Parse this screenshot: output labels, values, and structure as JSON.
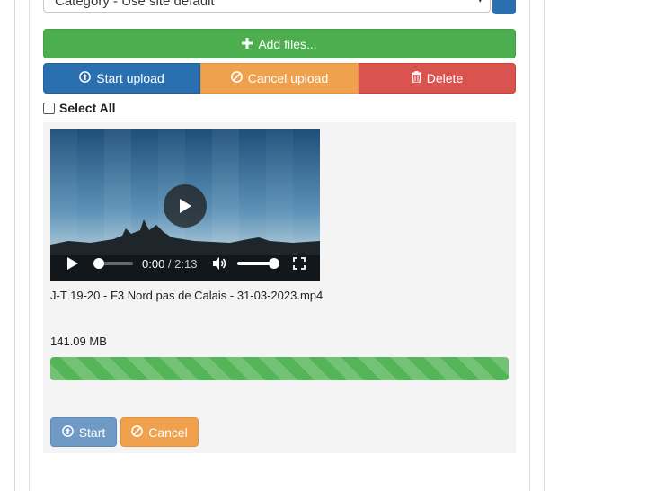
{
  "category_select": {
    "value": "Category - Use site default"
  },
  "toolbar": {
    "add_files": "Add files...",
    "start_upload": "Start upload",
    "cancel_upload": "Cancel upload",
    "delete": "Delete",
    "select_all": "Select All"
  },
  "file": {
    "name": "J-T 19-20 - F3 Nord pas de Calais - 31-03-2023.mp4",
    "size": "141.09 MB",
    "progress_percent": 100,
    "player": {
      "current_time": "0:00",
      "separator": " / ",
      "duration": "2:13"
    },
    "start_label": "Start",
    "cancel_label": "Cancel"
  },
  "colors": {
    "green": "#4cae4f",
    "blue": "#2a6fb0",
    "orange": "#f0a14d",
    "red": "#d9534f",
    "light_blue": "#6f9ac6"
  },
  "icons": {
    "add": "plus-icon",
    "start_upload": "circle-arrow-up-icon",
    "cancel_upload": "ban-icon",
    "delete": "trash-icon",
    "play": "play-icon",
    "volume": "volume-icon",
    "fullscreen": "fullscreen-icon"
  }
}
